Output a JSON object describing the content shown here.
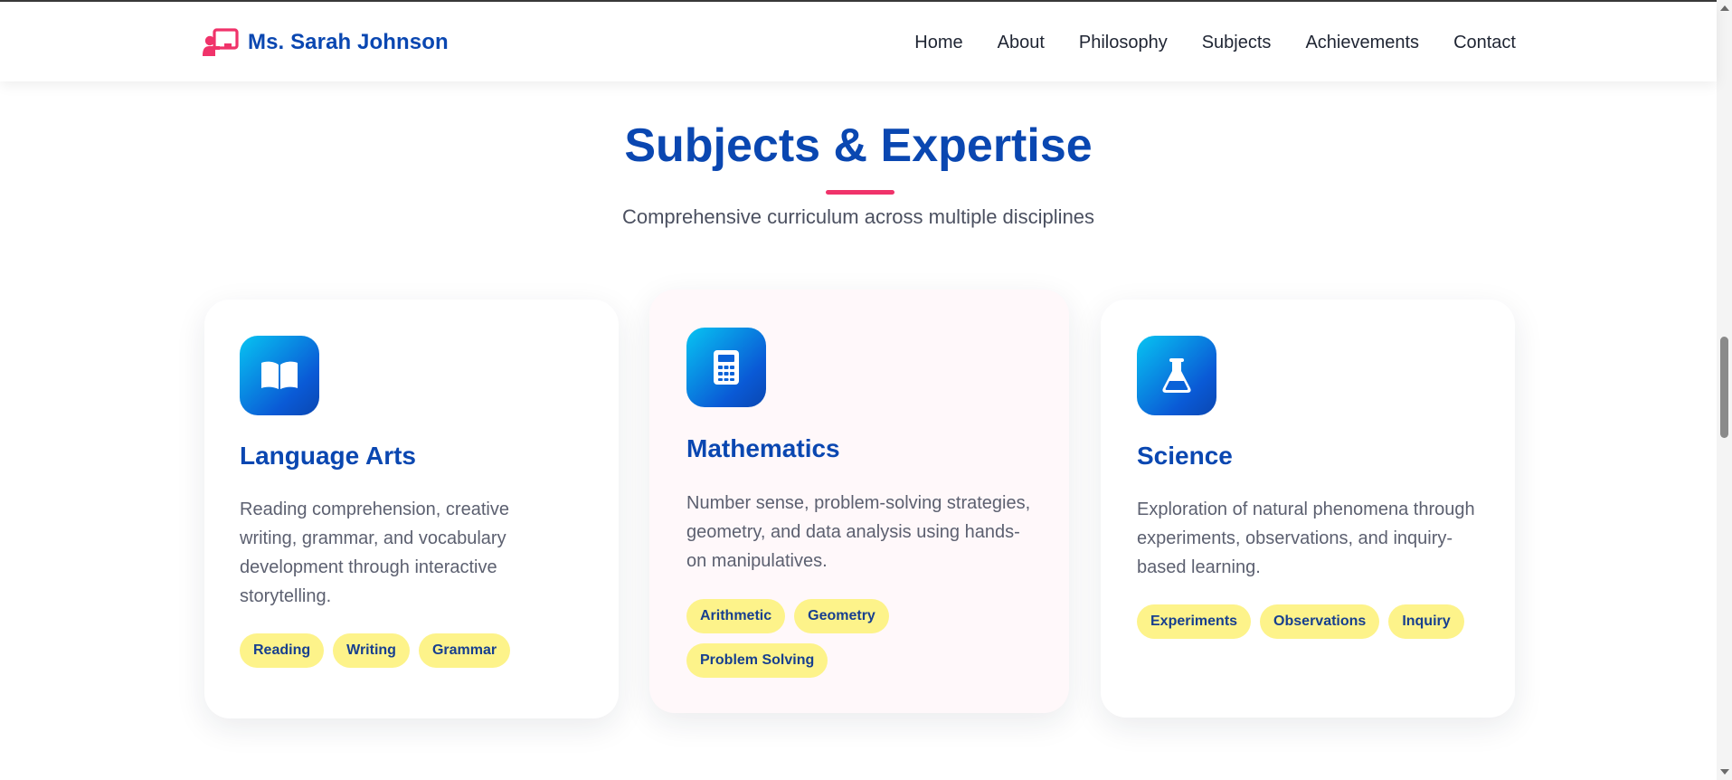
{
  "brand": {
    "name": "Ms. Sarah Johnson",
    "icon": "chalkboard-teacher-icon",
    "color": "#0a47b1",
    "icon_color": "#f0336a"
  },
  "nav": {
    "items": [
      "Home",
      "About",
      "Philosophy",
      "Subjects",
      "Achievements",
      "Contact"
    ]
  },
  "section": {
    "title": "Subjects & Expertise",
    "subtitle": "Comprehensive curriculum across multiple disciplines",
    "accent_color": "#f0336a"
  },
  "cards": [
    {
      "icon": "book-open-icon",
      "title": "Language Arts",
      "description": "Reading comprehension, creative writing, grammar, and vocabulary development through interactive storytelling.",
      "tags": [
        "Reading",
        "Writing",
        "Grammar"
      ]
    },
    {
      "icon": "calculator-icon",
      "title": "Mathematics",
      "description": "Number sense, problem-solving strategies, geometry, and data analysis using hands-on manipulatives.",
      "tags": [
        "Arithmetic",
        "Geometry",
        "Problem Solving"
      ]
    },
    {
      "icon": "flask-icon",
      "title": "Science",
      "description": "Exploration of natural phenomena through experiments, observations, and inquiry-based learning.",
      "tags": [
        "Experiments",
        "Observations",
        "Inquiry"
      ]
    }
  ],
  "colors": {
    "tag_background": "#fdf38a",
    "tag_text": "#173f8f",
    "icon_gradient_start": "#08c4f2",
    "icon_gradient_end": "#0a47b1"
  }
}
